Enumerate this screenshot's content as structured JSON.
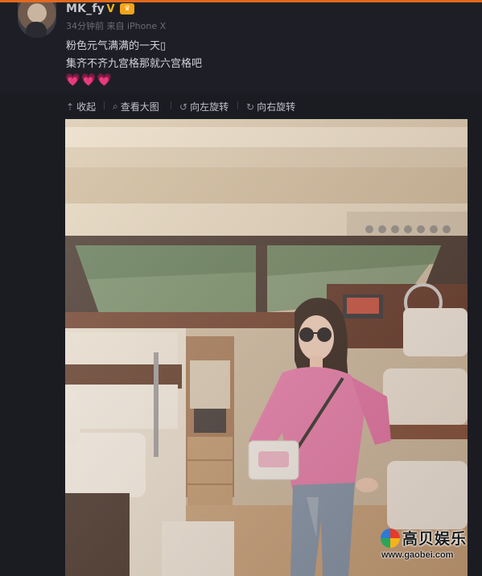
{
  "post": {
    "username": "MK_fy",
    "verified_icon": "verified-v-icon",
    "vip_icon": "vip-crown-icon",
    "meta": "34分钟前 来自 iPhone X",
    "line1": "粉色元气满满的一天▯",
    "line2": "集齐不齐九宫格那就六宫格吧",
    "hearts": "💗💗💗"
  },
  "actions": {
    "collapse": "收起",
    "view_large": "查看大图",
    "rotate_left": "向左旋转",
    "rotate_right": "向右旋转"
  },
  "watermark": {
    "title": "高贝娱乐",
    "url": "www.gaobei.com"
  },
  "colors": {
    "accent": "#e2691f",
    "background": "#1b1c22",
    "text": "#d2d3da",
    "muted": "#6a6c77",
    "heart": "#ff4fa8",
    "sweater": "#e97bb0"
  }
}
